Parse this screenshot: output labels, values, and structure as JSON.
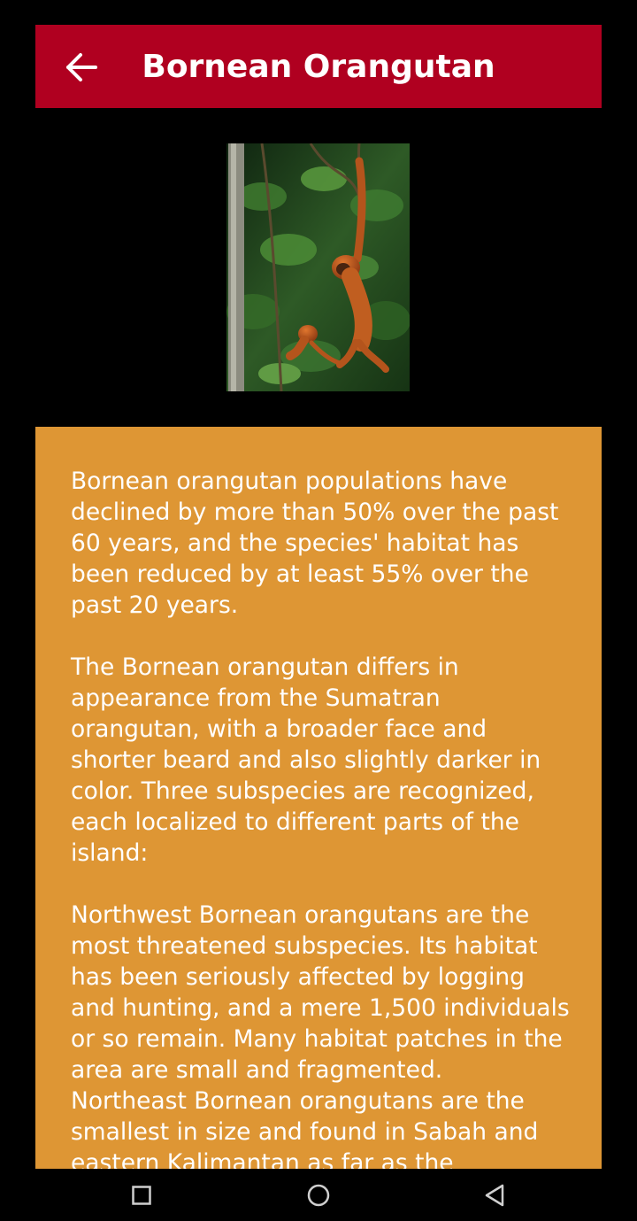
{
  "header": {
    "title": "Bornean Orangutan",
    "back_icon": "arrow-left-icon",
    "color": "#b00020"
  },
  "photo": {
    "subject": "orangutan-photo"
  },
  "content": {
    "background": "#de9634",
    "paragraphs": [
      "Bornean orangutan populations have declined by more than 50% over the past 60 years, and the species' habitat has been reduced by at least 55% over the past 20 years.",
      "The Bornean orangutan differs in appearance from the Sumatran orangutan, with a broader face and shorter beard and also slightly darker in color. Three subspecies are recognized, each localized to different parts of the island:",
      "Northwest Bornean orangutans are the most threatened subspecies. Its habitat has been seriously affected by logging and hunting, and a mere 1,500 individuals or so remain. Many habitat patches in the area are small and fragmented.\nNortheast Bornean orangutans are the smallest in size and found in Sabah and eastern Kalimantan as far as the"
    ]
  },
  "nav": {
    "recents_icon": "square-icon",
    "home_icon": "circle-icon",
    "back_icon": "triangle-back-icon"
  }
}
